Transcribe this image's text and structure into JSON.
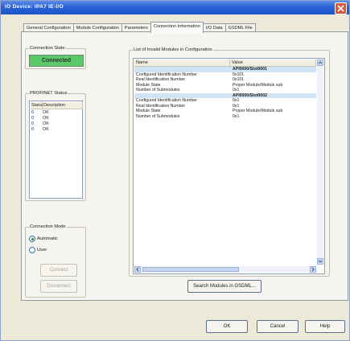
{
  "window": {
    "title": "IO Device: IPA7 IE-I/O"
  },
  "tabs": [
    "General Configuration",
    "Module Configuration",
    "Parameters",
    "Connection Information",
    "I/O Data",
    "GSDML File"
  ],
  "active_tab": "Connection Information",
  "connection_state": {
    "label": "Connection State",
    "value": "Connected"
  },
  "profinet_status": {
    "label": "PROFINET Status",
    "columns": [
      "Status",
      "Description"
    ],
    "rows": [
      {
        "status": "0",
        "description": "OK"
      },
      {
        "status": "0",
        "description": "OK"
      },
      {
        "status": "0",
        "description": "OK"
      },
      {
        "status": "0",
        "description": "OK"
      }
    ]
  },
  "connection_mode": {
    "label": "Connection Mode",
    "automatic_label": "Automatic",
    "user_label": "User",
    "selected": "Automatic",
    "connect_label": "Connect",
    "disconnect_label": "Disconnect"
  },
  "invalid_modules": {
    "label": "List of Invalid Modules in Configuration",
    "columns": [
      "Name",
      "Value"
    ],
    "rows": [
      {
        "name": "",
        "value": "API0000/Slot0001",
        "header": true
      },
      {
        "name": "Configured Identification Number",
        "value": "0x101"
      },
      {
        "name": "Real Identification Number",
        "value": "0x101"
      },
      {
        "name": "Module State",
        "value": "Proper Module/Module sub"
      },
      {
        "name": "Number of Submodules",
        "value": "0x1"
      },
      {
        "name": "",
        "value": "API0000/Slot0002",
        "header": true
      },
      {
        "name": "Configured Identification Number",
        "value": "0x1"
      },
      {
        "name": "Real Identification Number",
        "value": "0x1"
      },
      {
        "name": "Module State",
        "value": "Proper Module/Module sub"
      },
      {
        "name": "Number of Submodules",
        "value": "0x1"
      }
    ],
    "search_button": "Search Modules in GSDML..."
  },
  "dialog_buttons": {
    "ok": "OK",
    "cancel": "Cancel",
    "help": "Help"
  }
}
